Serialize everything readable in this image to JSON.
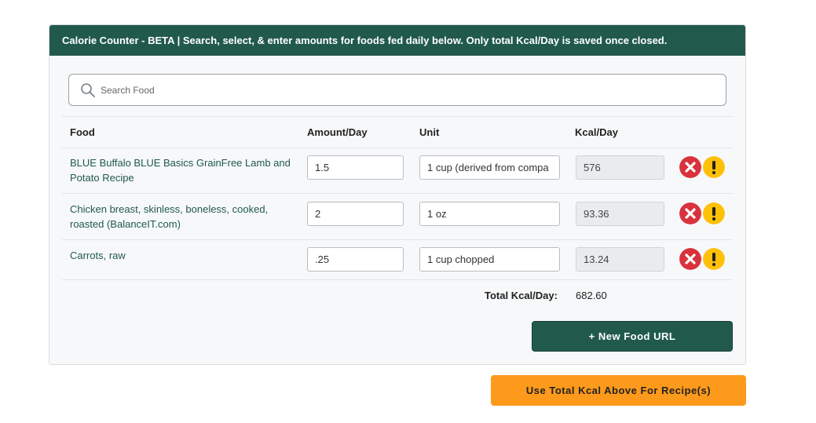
{
  "header": {
    "title": "Calorie Counter - BETA | Search, select, & enter amounts for foods fed daily below. Only total Kcal/Day is saved once closed."
  },
  "search": {
    "placeholder": "Search Food",
    "value": ""
  },
  "table": {
    "columns": [
      "Food",
      "Amount/Day",
      "Unit",
      "Kcal/Day"
    ],
    "rows": [
      {
        "food": "BLUE Buffalo BLUE Basics GrainFree Lamb and Potato Recipe",
        "amount": "1.5",
        "unit": "1 cup (derived from compa",
        "kcal": "576"
      },
      {
        "food": "Chicken breast, skinless, boneless, cooked, roasted (BalanceIT.com)",
        "amount": "2",
        "unit": "1 oz",
        "kcal": "93.36"
      },
      {
        "food": "Carrots, raw",
        "amount": ".25",
        "unit": "1 cup chopped",
        "kcal": "13.24"
      }
    ],
    "total_label": "Total Kcal/Day:",
    "total_value": "682.60"
  },
  "buttons": {
    "new_food": "+ New Food URL",
    "use_total": "Use Total Kcal Above For Recipe(s)"
  },
  "icons": {
    "search": "search-icon",
    "remove": "close-circle-icon",
    "warning": "exclamation-circle-icon"
  },
  "colors": {
    "brand_green": "#215a4d",
    "accent_orange": "#fd9a1b",
    "danger_red": "#d9323c",
    "warning_yellow": "#ffc107"
  }
}
